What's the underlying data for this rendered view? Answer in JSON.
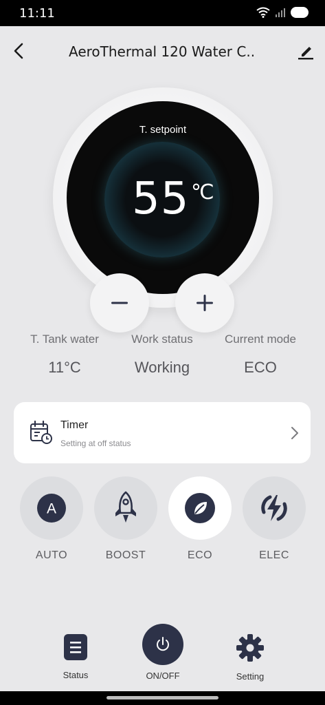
{
  "status_bar": {
    "time": "11:11"
  },
  "header": {
    "title": "AeroThermal 120 Water C..."
  },
  "dial": {
    "label": "T. setpoint",
    "value": "55",
    "unit": "℃"
  },
  "stats": [
    {
      "label": "T. Tank water",
      "value": "11°C"
    },
    {
      "label": "Work status",
      "value": "Working"
    },
    {
      "label": "Current mode",
      "value": "ECO"
    }
  ],
  "timer": {
    "title": "Timer",
    "subtitle": "Setting at off status"
  },
  "modes": [
    {
      "label": "AUTO",
      "icon": "auto-icon",
      "active": false
    },
    {
      "label": "BOOST",
      "icon": "rocket-icon",
      "active": false
    },
    {
      "label": "ECO",
      "icon": "leaf-icon",
      "active": true
    },
    {
      "label": "ELEC",
      "icon": "lightning-icon",
      "active": false
    }
  ],
  "bottom_nav": {
    "status_label": "Status",
    "onoff_label": "ON/OFF",
    "setting_label": "Setting"
  },
  "colors": {
    "accent_dark": "#2d3248",
    "background": "#e8e8ea",
    "dial_glow": "#2d6475"
  }
}
